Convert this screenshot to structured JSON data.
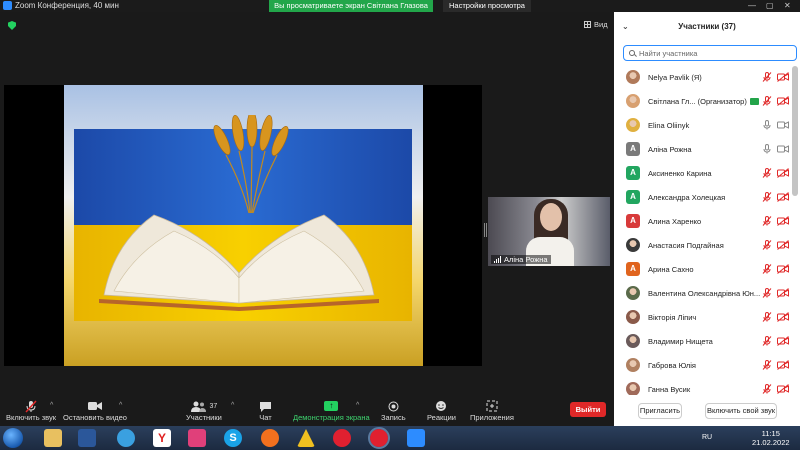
{
  "window": {
    "title": "Zoom Конференция, 40 мин",
    "share_banner": "Вы просматриваете экран Світлана Глазова",
    "view_options": "Настройки просмотра",
    "view_button": "Вид"
  },
  "self_video": {
    "name": "Аліна Рожна"
  },
  "toolbar": {
    "unmute": "Включить звук",
    "stop_video": "Остановить видео",
    "participants": "Участники",
    "participants_count": "37",
    "chat": "Чат",
    "share_screen": "Демонстрация экрана",
    "record": "Запись",
    "reactions": "Реакции",
    "apps": "Приложения",
    "leave": "Выйти"
  },
  "panel": {
    "title": "Участники (37)",
    "search_placeholder": "Найти участника",
    "invite": "Пригласить",
    "unmute_me": "Включить свой звук",
    "participants": [
      {
        "name": "Nelya Pavlik (Я)",
        "avatar": "photo",
        "color": "#b07a5a",
        "mic": "muted",
        "cam": "off"
      },
      {
        "name": "Світлана Гл... (Организатор)",
        "avatar": "photo",
        "color": "#d8a070",
        "host_badge": true,
        "mic": "muted",
        "cam": "off"
      },
      {
        "name": "Elina Oliinyk",
        "avatar": "photo",
        "color": "#e0b040",
        "mic": "on",
        "cam": "on"
      },
      {
        "name": "Аліна Рожна",
        "avatar": "А",
        "color": "#7a7a7a",
        "mic": "on",
        "cam": "on"
      },
      {
        "name": "Аксиненко Карина",
        "avatar": "А",
        "color": "#22a660",
        "mic": "muted",
        "cam": "off"
      },
      {
        "name": "Александра Холецкая",
        "avatar": "А",
        "color": "#22a660",
        "mic": "muted",
        "cam": "off"
      },
      {
        "name": "Алина Харенко",
        "avatar": "А",
        "color": "#d83a3a",
        "mic": "muted",
        "cam": "off"
      },
      {
        "name": "Анастасия Подгайная",
        "avatar": "photo",
        "color": "#3a3a3a",
        "mic": "muted",
        "cam": "off"
      },
      {
        "name": "Арина Сахно",
        "avatar": "А",
        "color": "#e0641e",
        "mic": "muted",
        "cam": "off"
      },
      {
        "name": "Валентина Олександрівна Юн...",
        "avatar": "photo",
        "color": "#5a6a4a",
        "mic": "muted",
        "cam": "off"
      },
      {
        "name": "Вікторія Ліпич",
        "avatar": "photo",
        "color": "#8a5a4a",
        "mic": "muted",
        "cam": "off"
      },
      {
        "name": "Владимир Нищета",
        "avatar": "photo",
        "color": "#6a5a5a",
        "mic": "muted",
        "cam": "off"
      },
      {
        "name": "Габрова Юлія",
        "avatar": "photo",
        "color": "#b08060",
        "mic": "muted",
        "cam": "off"
      },
      {
        "name": "Ганна Вусик",
        "avatar": "photo",
        "color": "#a06a5a",
        "mic": "muted",
        "cam": "off"
      }
    ]
  },
  "taskbar": {
    "language": "RU",
    "time": "11:15",
    "date": "21.02.2022"
  }
}
